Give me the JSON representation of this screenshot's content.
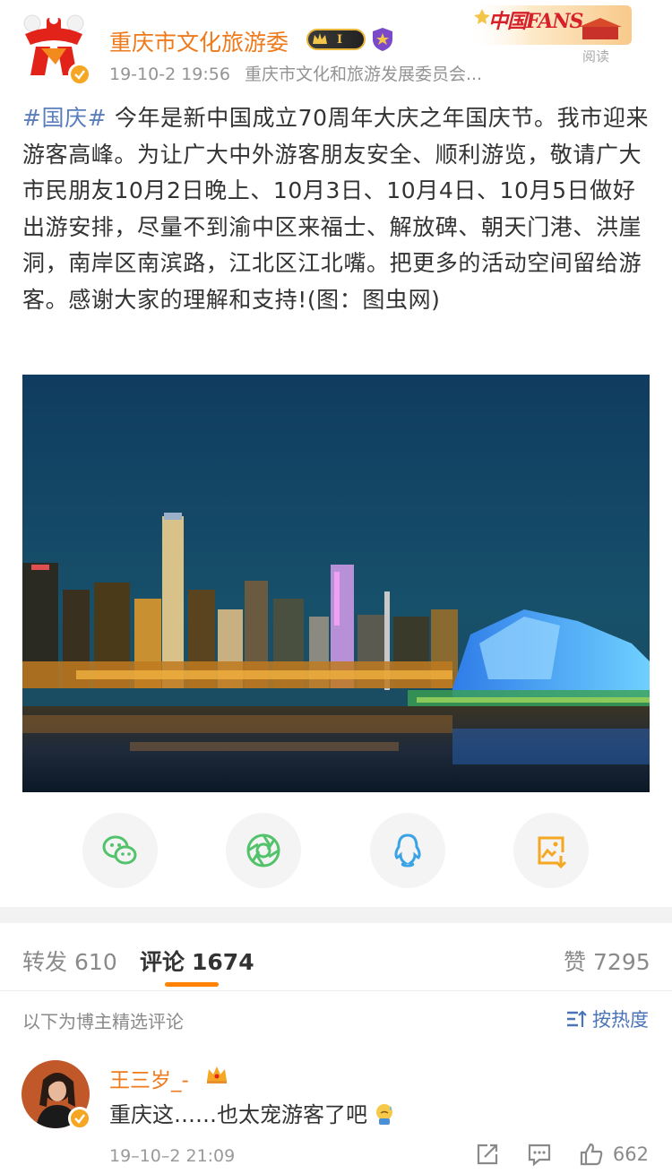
{
  "header": {
    "author": "重庆市文化旅游委",
    "level_badge": "I",
    "date": "19-10-2 19:56",
    "source": "重庆市文化和旅游发展委员会...",
    "fans_banner": "中国FANS",
    "read_label": "阅读"
  },
  "post": {
    "hashtag": "#国庆#",
    "body": " 今年是新中国成立70周年大庆之年国庆节。我市迎来游客高峰。为让广大中外游客朋友安全、顺利游览，敬请广大市民朋友10月2日晚上、10月3日、10月4日、10月5日做好出游安排，尽量不到渝中区来福士、解放碑、朝天门港、洪崖洞，南岸区南滨路，江北区江北嘴。把更多的活动空间留给游客。感谢大家的理解和支持!(图：图虫网)"
  },
  "share": [
    {
      "name": "wechat-icon",
      "color": "#52c26b"
    },
    {
      "name": "moments-icon",
      "color": "#52c26b"
    },
    {
      "name": "qq-icon",
      "color": "#3aa3e6"
    },
    {
      "name": "save-image-icon",
      "color": "#f5a623"
    }
  ],
  "tabs": {
    "repost_label": "转发",
    "repost_count": "610",
    "comment_label": "评论",
    "comment_count": "1674",
    "like_label": "赞",
    "like_count": "7295"
  },
  "comments_header": {
    "subtitle": "以下为博主精选评论",
    "sort_label": "按热度"
  },
  "comment": {
    "name": "王三岁_-",
    "text": "重庆这……也太宠游客了吧",
    "time": "19–10–2 21:09",
    "likes": "662"
  },
  "colors": {
    "accent_orange": "#ff8200",
    "name_orange": "#ee7a1c",
    "link_blue": "#5b7ebd"
  }
}
